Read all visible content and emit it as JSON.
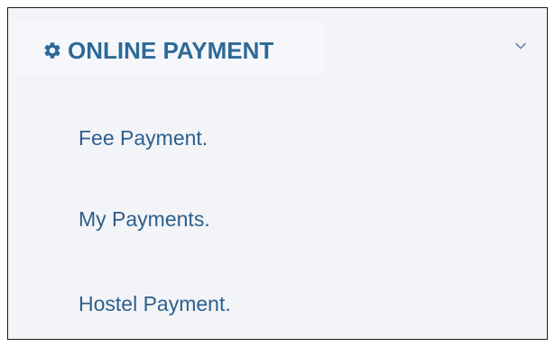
{
  "menu": {
    "header_label": "ONLINE PAYMENT",
    "header_icon": "gear-icon",
    "expand_icon": "chevron-down-icon",
    "accent_color": "#2d6a99",
    "items": [
      {
        "label": "Fee Payment."
      },
      {
        "label": "My Payments."
      },
      {
        "label": "Hostel Payment."
      }
    ]
  }
}
